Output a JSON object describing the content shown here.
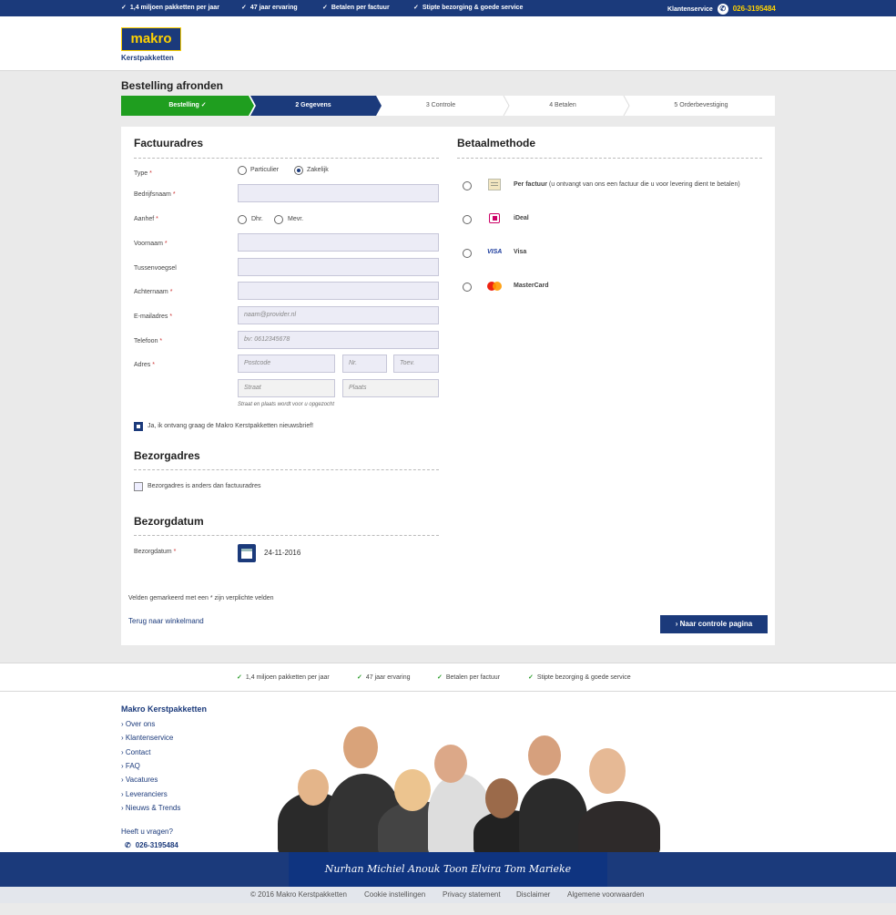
{
  "topbar": {
    "usps": [
      "1,4 miljoen pakketten per jaar",
      "47 jaar ervaring",
      "Betalen per factuur",
      "Stipte bezorging & goede service"
    ],
    "service_label": "Klantenservice",
    "service_phone": "026-3195484"
  },
  "header": {
    "logo_text": "makro",
    "logo_sub": "Kerstpakketten"
  },
  "page_title": "Bestelling afronden",
  "steps": [
    "Bestelling ✓",
    "2 Gegevens",
    "3 Controle",
    "4 Betalen",
    "5 Orderbevestiging"
  ],
  "factuur": {
    "title": "Factuuradres",
    "type_label": "Type",
    "type_options": [
      "Particulier",
      "Zakelijk"
    ],
    "bedrijf_label": "Bedrijfsnaam",
    "aanhef_label": "Aanhef",
    "aanhef_options": [
      "Dhr.",
      "Mevr."
    ],
    "voornaam_label": "Voornaam",
    "tussen_label": "Tussenvoegsel",
    "achternaam_label": "Achternaam",
    "email_label": "E-mailadres",
    "email_placeholder": "naam@provider.nl",
    "telefoon_label": "Telefoon",
    "telefoon_placeholder": "bv: 0612345678",
    "adres_label": "Adres",
    "postcode_placeholder": "Postcode",
    "nr_placeholder": "Nr.",
    "toev_placeholder": "Toev.",
    "straat_placeholder": "Straat",
    "plaats_placeholder": "Plaats",
    "adres_hint": "Straat en plaats wordt voor u opgezocht",
    "newsletter": "Ja, ik ontvang graag de Makro Kerstpakketten nieuwsbrief!"
  },
  "bezorg": {
    "title": "Bezorgadres",
    "checkbox": "Bezorgadres is anders dan factuuradres"
  },
  "datum": {
    "title": "Bezorgdatum",
    "label": "Bezorgdatum",
    "value": "24-11-2016"
  },
  "required_note": "Velden gemarkeerd met een * zijn verplichte velden",
  "back_link": "Terug naar winkelmand",
  "next_button": "› Naar controle pagina",
  "payment": {
    "title": "Betaalmethode",
    "methods": [
      {
        "name": "Per factuur",
        "note": "(u ontvangt van ons een factuur die u voor levering dient te betalen)"
      },
      {
        "name": "iDeal",
        "note": ""
      },
      {
        "name": "Visa",
        "note": ""
      },
      {
        "name": "MasterCard",
        "note": ""
      }
    ],
    "visa_logo": "VISA"
  },
  "footer": {
    "usps": [
      "1,4 miljoen pakketten per jaar",
      "47 jaar ervaring",
      "Betalen per factuur",
      "Stipte bezorging & goede service"
    ],
    "heading": "Makro Kerstpakketten",
    "links": [
      "› Over ons",
      "› Klantenservice",
      "› Contact",
      "› FAQ",
      "› Vacatures",
      "› Leveranciers",
      "› Nieuws & Trends"
    ],
    "question": "Heeft u vragen?",
    "phone": "026-3195484",
    "team_names": "Nurhan  Michiel  Anouk  Toon  Elvira  Tom  Marieke"
  },
  "bottom": [
    "© 2016 Makro Kerstpakketten",
    "Cookie instellingen",
    "Privacy statement",
    "Disclaimer",
    "Algemene voorwaarden"
  ],
  "colors": {
    "brand_blue": "#1b3a7b",
    "step_green": "#1f9e1f",
    "logo_yellow": "#ffd200"
  }
}
